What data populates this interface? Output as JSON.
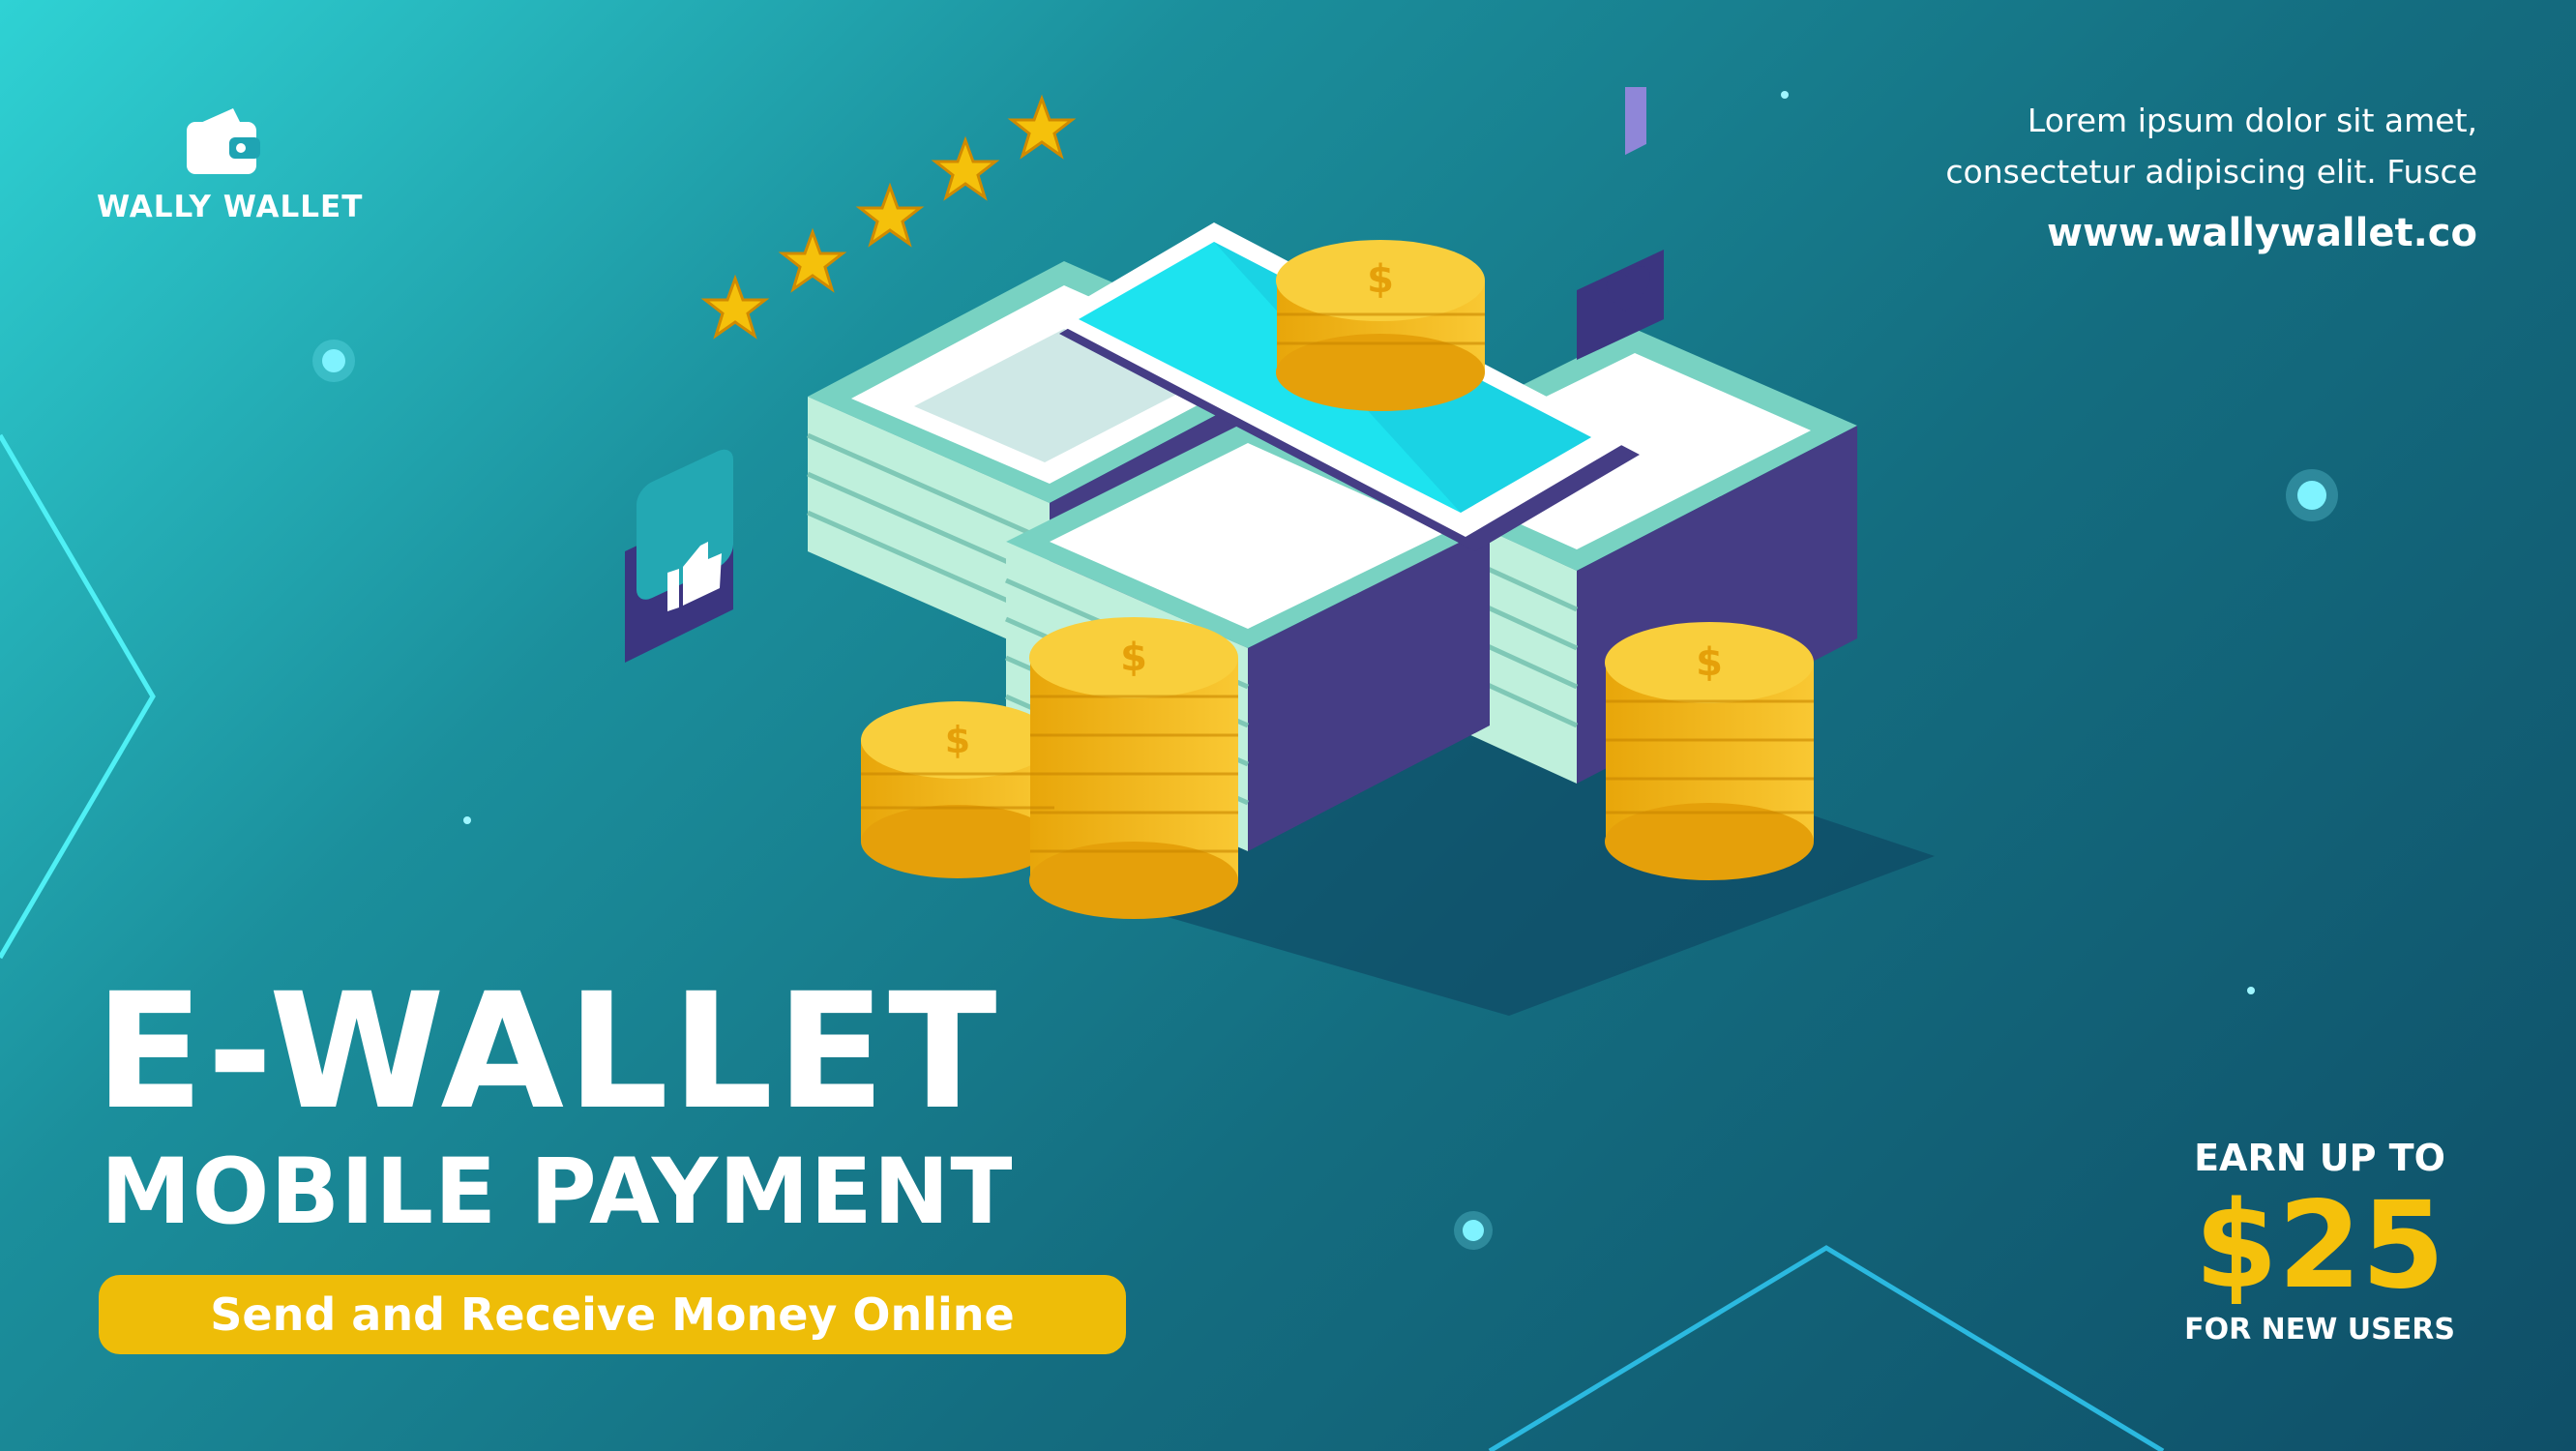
{
  "brand": {
    "name": "WALLY WALLET",
    "logo_icon": "wallet-icon"
  },
  "tagline": {
    "line1": "Lorem ipsum dolor sit amet,",
    "line2": "consectetur adipiscing elit. Fusce"
  },
  "website": "www.wallywallet.co",
  "headline": "E-WALLET",
  "subheadline": "MOBILE PAYMENT",
  "cta": {
    "label": "Send and Receive Money Online"
  },
  "promo": {
    "top": "EARN UP TO",
    "amount": "$25",
    "bottom": "FOR NEW USERS"
  },
  "rating": {
    "stars": 5,
    "icon": "star-icon"
  },
  "icons": {
    "like": "thumbs-up-icon",
    "favorite": "heart-icon",
    "currency": "dollar-coin-icon",
    "device": "smartphone-icon",
    "cash": "banknote-stack-icon"
  },
  "colors": {
    "accent_yellow": "#eebd08",
    "coin_gold": "#f5c10b",
    "bg_light": "#2fd2d4",
    "bg_dark": "#0f4f68",
    "glow_cyan": "#7ff3ff",
    "phone_screen": "#1de3ef"
  }
}
